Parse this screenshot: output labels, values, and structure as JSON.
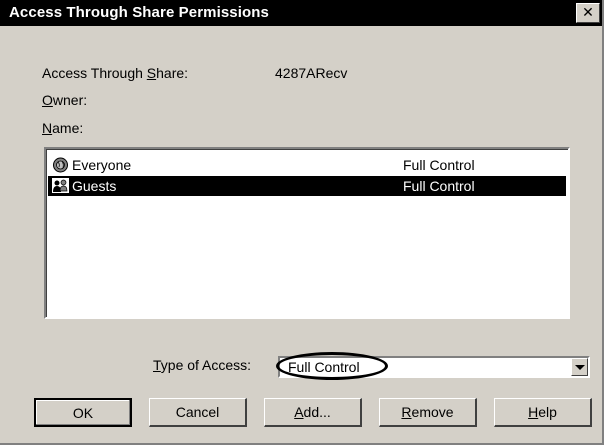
{
  "dialog": {
    "title": "Access Through Share Permissions",
    "close_label": "✕"
  },
  "fields": {
    "share_label_pre": "Access Through ",
    "share_label_accel": "S",
    "share_label_post": "hare:",
    "share_value": "4287ARecv",
    "owner_accel": "O",
    "owner_post": "wner:",
    "name_accel": "N",
    "name_post": "ame:"
  },
  "permissions": [
    {
      "name": "Everyone",
      "access": "Full Control",
      "icon": "globe-icon",
      "selected": false
    },
    {
      "name": "Guests",
      "access": "Full Control",
      "icon": "group-icon",
      "selected": true
    }
  ],
  "access_type": {
    "label_accel": "T",
    "label_post": "ype of Access:",
    "value": "Full Control"
  },
  "buttons": {
    "ok": "OK",
    "cancel": "Cancel",
    "add_accel": "A",
    "add_post": "dd...",
    "remove_accel": "R",
    "remove_post": "emove",
    "help_accel": "H",
    "help_post": "elp"
  }
}
